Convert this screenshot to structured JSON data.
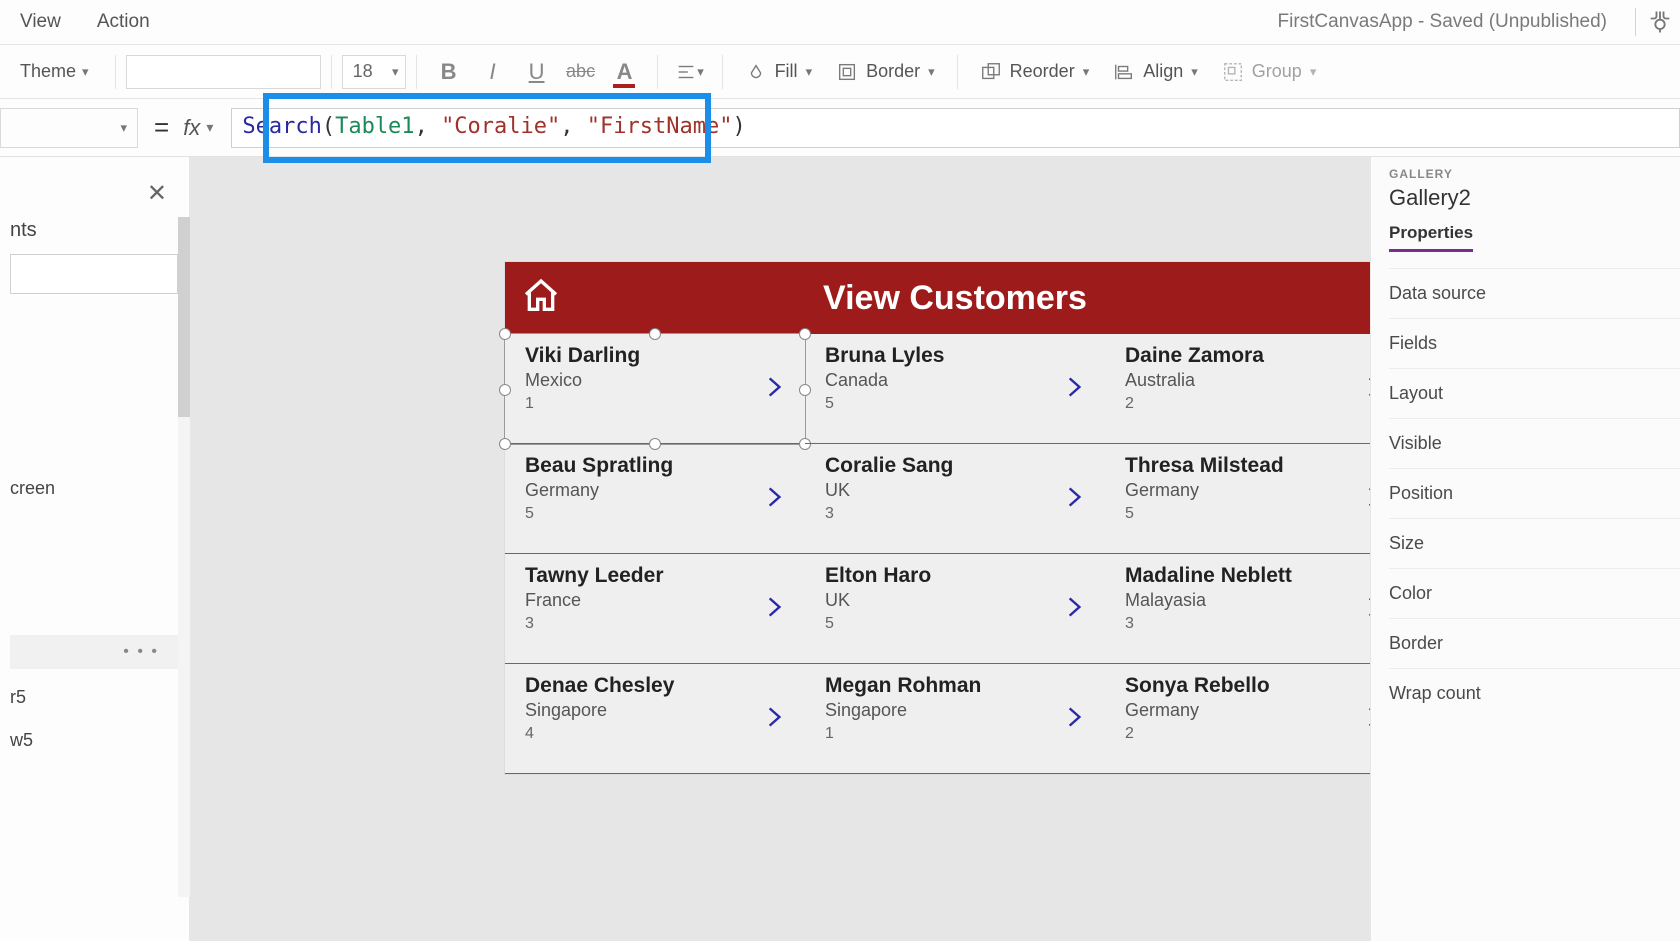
{
  "menubar": {
    "view": "View",
    "action": "Action"
  },
  "app_title": "FirstCanvasApp - Saved (Unpublished)",
  "toolbar": {
    "theme": "Theme",
    "font_size": "18",
    "fill": "Fill",
    "border": "Border",
    "reorder": "Reorder",
    "align": "Align",
    "group": "Group"
  },
  "formula": {
    "equals": "=",
    "fx": "fx",
    "fn": "Search",
    "id": "Table1",
    "str1": "\"Coralie\"",
    "str2": "\"FirstName\""
  },
  "left_pane": {
    "heading_suffix": "nts",
    "item_screen": "creen",
    "item_r5": "r5",
    "item_w5": "w5",
    "ellipsis": "• • •",
    "close": "✕"
  },
  "app_screen": {
    "title": "View Customers",
    "items": [
      {
        "name": "Viki  Darling",
        "loc": "Mexico",
        "num": "1"
      },
      {
        "name": "Bruna  Lyles",
        "loc": "Canada",
        "num": "5"
      },
      {
        "name": "Daine  Zamora",
        "loc": "Australia",
        "num": "2"
      },
      {
        "name": "Beau  Spratling",
        "loc": "Germany",
        "num": "5"
      },
      {
        "name": "Coralie  Sang",
        "loc": "UK",
        "num": "3"
      },
      {
        "name": "Thresa  Milstead",
        "loc": "Germany",
        "num": "5"
      },
      {
        "name": "Tawny  Leeder",
        "loc": "France",
        "num": "3"
      },
      {
        "name": "Elton  Haro",
        "loc": "UK",
        "num": "5"
      },
      {
        "name": "Madaline  Neblett",
        "loc": "Malayasia",
        "num": "3"
      },
      {
        "name": "Denae  Chesley",
        "loc": "Singapore",
        "num": "4"
      },
      {
        "name": "Megan  Rohman",
        "loc": "Singapore",
        "num": "1"
      },
      {
        "name": "Sonya  Rebello",
        "loc": "Germany",
        "num": "2"
      }
    ]
  },
  "right_pane": {
    "section": "GALLERY",
    "name": "Gallery2",
    "tab": "Properties",
    "rows": [
      "Data source",
      "Fields",
      "Layout",
      "Visible",
      "Position",
      "Size",
      "Color",
      "Border",
      "Wrap count"
    ]
  }
}
